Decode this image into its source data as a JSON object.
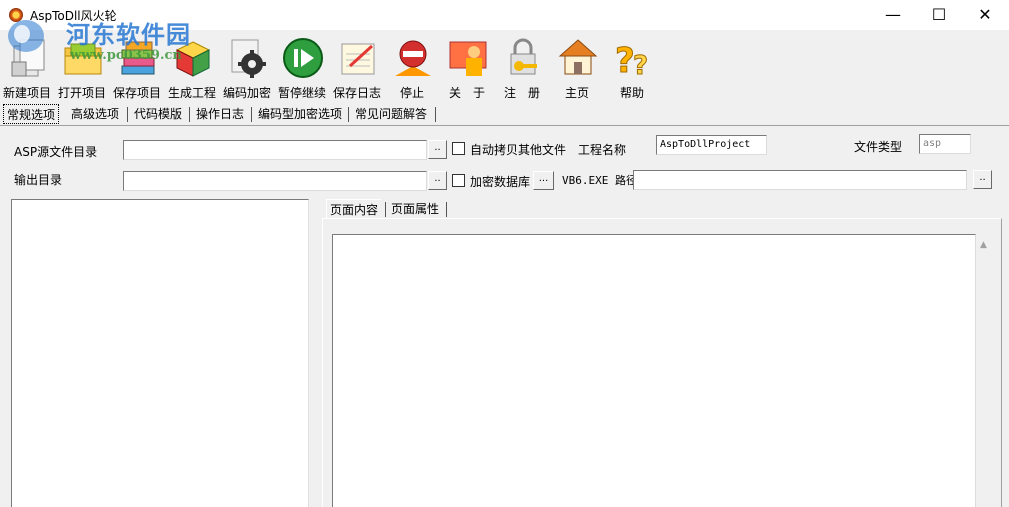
{
  "window": {
    "title": "AspToDll风火轮",
    "minimize_glyph": "—",
    "maximize_glyph": "☐",
    "close_glyph": "✕"
  },
  "watermark": {
    "text": "河东软件园",
    "url": "www.pc0359.cn"
  },
  "toolbar": {
    "items": [
      {
        "label": "新建项目",
        "icon": "new-project-icon"
      },
      {
        "label": "打开项目",
        "icon": "open-folder-icon"
      },
      {
        "label": "保存项目",
        "icon": "save-books-icon"
      },
      {
        "label": "生成工程",
        "icon": "build-cube-icon"
      },
      {
        "label": "编码加密",
        "icon": "gear-encrypt-icon"
      },
      {
        "label": "暂停继续",
        "icon": "pause-play-icon"
      },
      {
        "label": "保存日志",
        "icon": "save-log-icon"
      },
      {
        "label": "停止",
        "icon": "stop-sign-icon"
      },
      {
        "label": "关　于",
        "icon": "about-person-icon"
      },
      {
        "label": "注　册",
        "icon": "register-key-icon"
      },
      {
        "label": "主页",
        "icon": "home-icon"
      },
      {
        "label": "帮助",
        "icon": "help-icon"
      }
    ]
  },
  "tabs": [
    {
      "label": "常规选项",
      "active": true
    },
    {
      "label": "高级选项"
    },
    {
      "label": "代码模版"
    },
    {
      "label": "操作日志"
    },
    {
      "label": "编码型加密选项"
    },
    {
      "label": "常见问题解答"
    }
  ],
  "form": {
    "asp_dir_label": "ASP源文件目录",
    "asp_dir_value": "",
    "output_dir_label": "输出目录",
    "output_dir_value": "",
    "browse_glyph": "..",
    "copy_other_files_label": "自动拷贝其他文件",
    "copy_other_files_checked": false,
    "project_name_label": "工程名称",
    "project_name_value": "AspToDllProject",
    "file_type_label": "文件类型",
    "file_type_value": "asp",
    "encrypt_db_label": "加密数据库",
    "encrypt_db_checked": false,
    "encrypt_db_browse": "...",
    "vb6_path_label": "VB6.EXE 路径",
    "vb6_path_value": ""
  },
  "page_tabs": [
    {
      "label": "页面内容",
      "active": true
    },
    {
      "label": "页面属性"
    }
  ],
  "colors": {
    "window_bg": "#f0f0f0",
    "field_bg": "#ffffff",
    "watermark_blue": "#2878d2"
  }
}
